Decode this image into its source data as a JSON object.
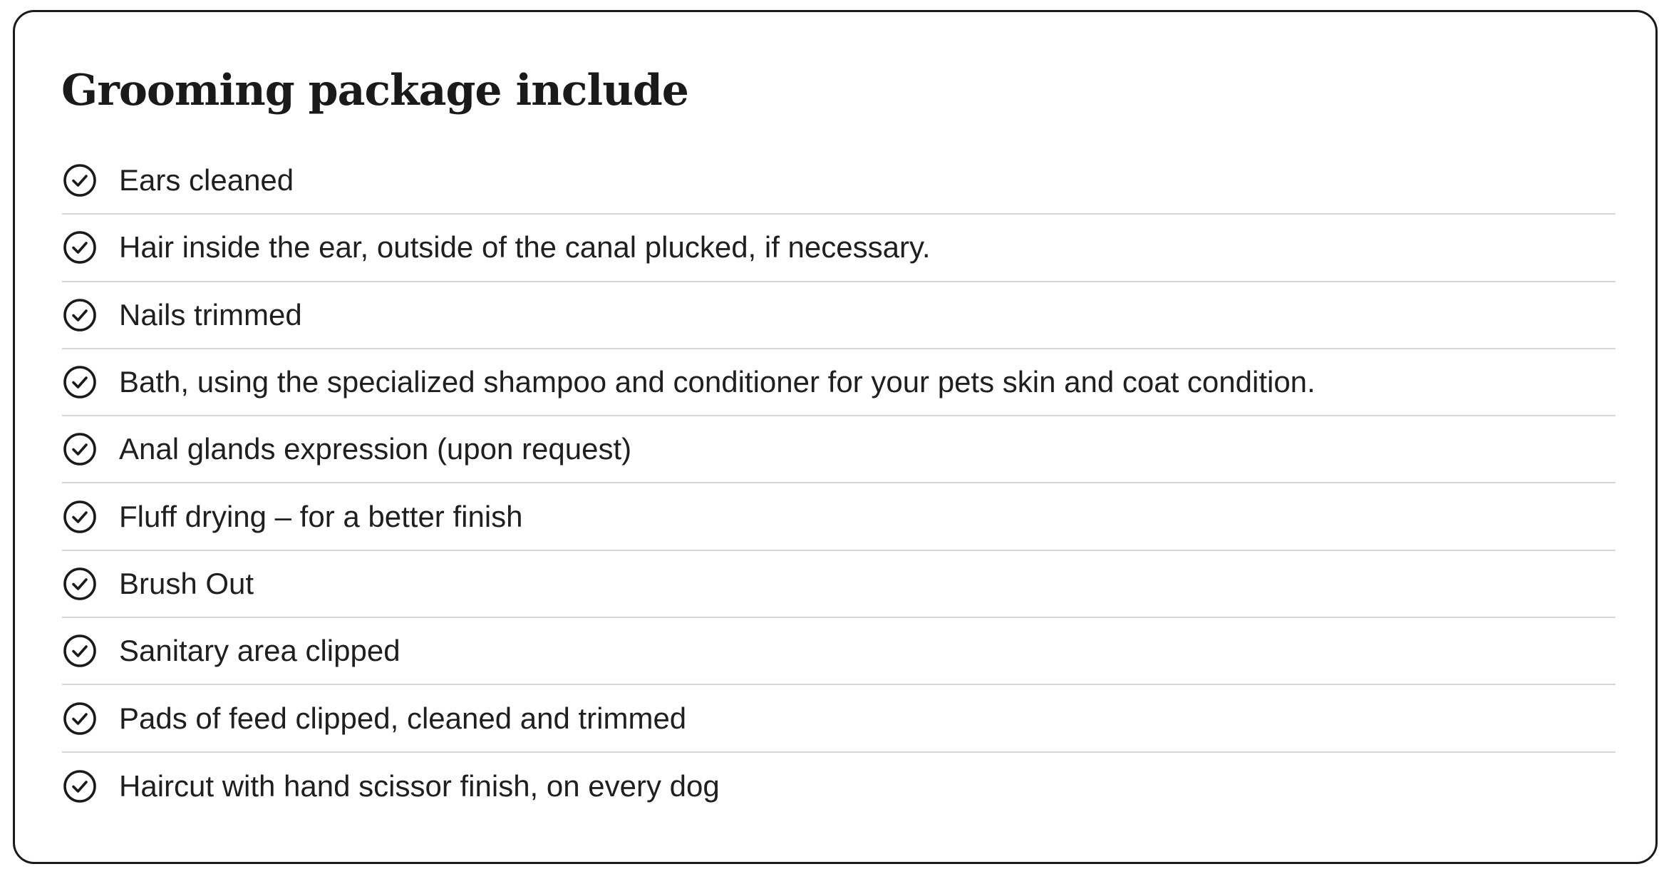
{
  "package": {
    "title": "Grooming package include",
    "check_icon": "check-circle-icon",
    "items": [
      {
        "label": "Ears cleaned"
      },
      {
        "label": "Hair inside the ear, outside of the canal plucked, if necessary."
      },
      {
        "label": "Nails trimmed"
      },
      {
        "label": "Bath, using the specialized shampoo and conditioner for your pets skin and coat condition."
      },
      {
        "label": "Anal glands expression (upon request)"
      },
      {
        "label": "Fluff drying – for a better finish"
      },
      {
        "label": "Brush Out"
      },
      {
        "label": "Sanitary area clipped"
      },
      {
        "label": "Pads of feed clipped, cleaned and trimmed"
      },
      {
        "label": "Haircut with hand scissor finish, on every dog"
      }
    ]
  },
  "colors": {
    "text": "#1f1f1f",
    "border": "#1a1a1a",
    "divider": "#d6d6d6",
    "background": "#ffffff"
  }
}
